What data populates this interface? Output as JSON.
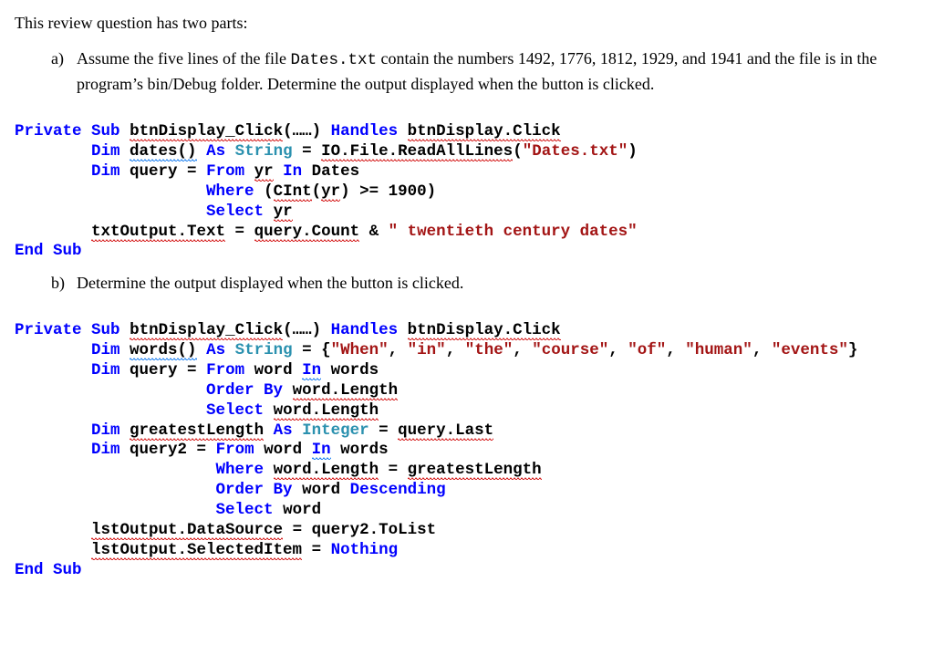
{
  "intro": "This review question has two parts:",
  "partA": {
    "label": "a)",
    "text_pre": "Assume the five lines of the file ",
    "filename": "Dates.txt",
    "text_post": " contain the numbers 1492, 1776, 1812, 1929, and 1941 and the file is in the program’s bin/Debug folder. Determine the output displayed when the button is clicked."
  },
  "partB": {
    "label": "b)",
    "text": "Determine the output displayed when the button is clicked."
  },
  "codeA": {
    "l1": {
      "a": "Private",
      "b": "Sub",
      "fn": "btnDisplay_Click",
      "paren": "(……)",
      "h": "Handles",
      "ev": "btnDisplay.Click"
    },
    "l2": {
      "dim": "Dim",
      "v": "dates()",
      "as": "As",
      "t": "String",
      "eq": " = ",
      "m": "IO.File.ReadAllLines",
      "op": "(",
      "s": "\"Dates.txt\"",
      "cp": ")"
    },
    "l3": {
      "dim": "Dim",
      "v": "query = ",
      "from": "From",
      "yr": "yr",
      "in": "In",
      "d": "Dates"
    },
    "l4": {
      "where": "Where",
      "op": "(",
      "ci": "CInt",
      "op2": "(",
      "yr": "yr",
      "cp2": ")",
      "ge": " >= 1900)"
    },
    "l5": {
      "sel": "Select",
      "yr": "yr"
    },
    "l6": {
      "a": "txtOutput.Text",
      "eq": " = ",
      "q": "query.Count",
      "amp": " & ",
      "s": "\" twentieth century dates\""
    },
    "l7": {
      "a": "End",
      "b": "Sub"
    }
  },
  "codeB": {
    "l1": {
      "a": "Private",
      "b": "Sub",
      "fn": "btnDisplay_Click",
      "paren": "(……)",
      "h": "Handles",
      "ev": "btnDisplay.Click"
    },
    "l2": {
      "dim": "Dim",
      "v": "words()",
      "as": "As",
      "t": "String",
      "eq": " = {",
      "s1": "\"When\"",
      "c1": ", ",
      "s2": "\"in\"",
      "c2": ", ",
      "s3": "\"the\"",
      "c3": ", ",
      "s4": "\"course\"",
      "c4": ", ",
      "s5": "\"of\"",
      "c5": ", ",
      "s6": "\"human\"",
      "c6": ", ",
      "s7": "\"events\"",
      "cb": "}"
    },
    "l3": {
      "dim": "Dim",
      "v": "query = ",
      "from": "From",
      "w": "word ",
      "in": "In",
      "ws": " words"
    },
    "l4": {
      "ob": "Order By",
      "wl": "word.Length"
    },
    "l5": {
      "sel": "Select",
      "wl": "word.Length"
    },
    "l6": {
      "dim": "Dim",
      "v": "greatestLength",
      "as": "As",
      "t": "Integer",
      "eq": " = ",
      "ql": "query.Last"
    },
    "l7": {
      "dim": "Dim",
      "v": "query2 = ",
      "from": "From",
      "w": "word ",
      "in": "In",
      "ws": " words"
    },
    "l8": {
      "where": "Where",
      "wl": "word.Length",
      "eq": " = ",
      "gl": "greatestLength"
    },
    "l9": {
      "ob": "Order By",
      "w": " word ",
      "desc": "Descending"
    },
    "l10": {
      "sel": "Select",
      "w": " word"
    },
    "l11": {
      "a": "lstOutput.DataSource",
      "eq": " = query2.ToList"
    },
    "l12": {
      "a": "lstOutput.SelectedItem",
      "eq": " = ",
      "n": "Nothing"
    },
    "l13": {
      "a": "End",
      "b": "Sub"
    }
  }
}
